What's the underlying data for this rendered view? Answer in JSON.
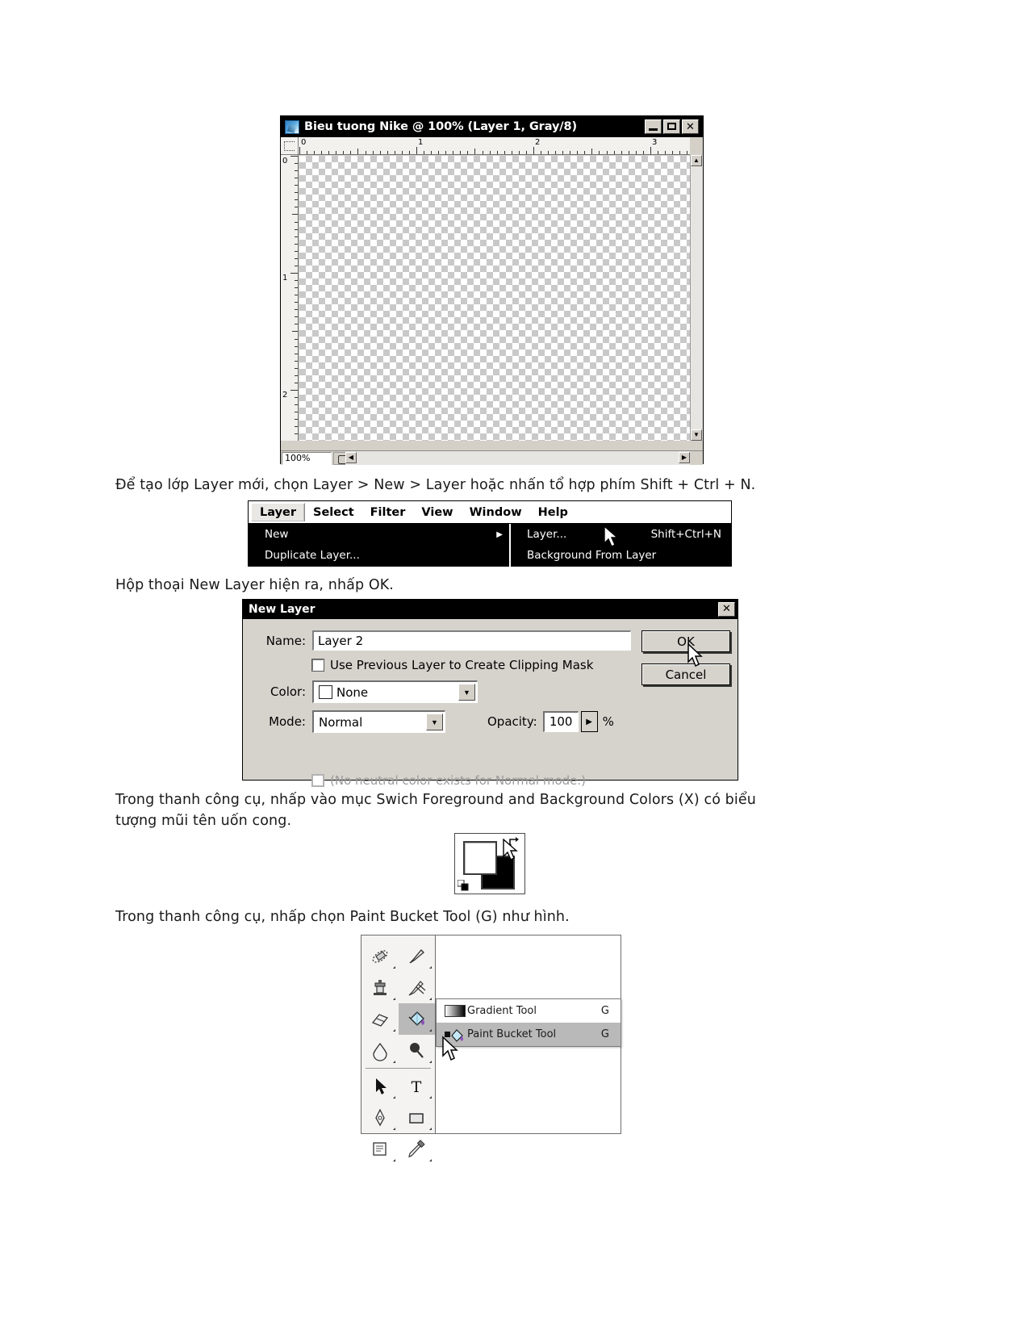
{
  "document_window": {
    "title": "Bieu tuong Nike @ 100% (Layer 1, Gray/8)",
    "app_icon": "photoshop-document-icon",
    "buttons": {
      "minimize": "_",
      "maximize": "□",
      "close": "✕"
    },
    "ruler_h_labels": [
      "0",
      "1",
      "2",
      "3"
    ],
    "ruler_v_labels": [
      "0",
      "1",
      "2"
    ],
    "status": {
      "zoom": "100%",
      "doc_icon": "document-thumbnail-icon"
    }
  },
  "text_blocks": {
    "intro": "Để tạo lớp Layer mới, chọn Layer > New > Layer hoặc nhấn tổ hợp phím Shift + Ctrl + N.",
    "dialog_caption": "Hộp thoại New Layer hiện ra, nhấp OK.",
    "swatch_caption_line1": "Trong thanh công cụ, nhấp vào mục Swich Foreground and Background Colors (X) có biểu",
    "swatch_caption_line2": "tượng mũi tên uốn cong.",
    "bucket_caption": "Trong thanh công cụ, nhấp chọn Paint Bucket Tool (G) như hình."
  },
  "menu_strip": {
    "menubar": [
      {
        "label": "Layer",
        "active": true
      },
      {
        "label": "Select",
        "active": false
      },
      {
        "label": "Filter",
        "active": false
      },
      {
        "label": "View",
        "active": false
      },
      {
        "label": "Window",
        "active": false
      },
      {
        "label": "Help",
        "active": false
      }
    ],
    "layer_menu": [
      {
        "label": "New",
        "submenu_arrow": "▶"
      },
      {
        "label": "Duplicate Layer...",
        "submenu_arrow": ""
      }
    ],
    "new_submenu": [
      {
        "label": "Layer...",
        "accel": "Shift+Ctrl+N"
      },
      {
        "label": "Background From Layer",
        "accel": ""
      }
    ],
    "cursor": "mouse-pointer-cursor"
  },
  "new_layer_dialog": {
    "title": "New Layer",
    "close_label": "✕",
    "name_label": "Name:",
    "name_value": "Layer 2",
    "clipping_checkbox_label": "Use Previous Layer to Create Clipping Mask",
    "clipping_checked": false,
    "color_label": "Color:",
    "color_value": "None",
    "color_swatch": "#ffffff",
    "mode_label": "Mode:",
    "mode_value": "Normal",
    "opacity_label": "Opacity:",
    "opacity_value": "100",
    "opacity_unit": "%",
    "neutral_note": "(No neutral color exists for Normal mode.)",
    "neutral_checked": false,
    "ok_label": "OK",
    "cancel_label": "Cancel",
    "cursor": "mouse-pointer-cursor"
  },
  "swatch_widget": {
    "foreground_color": "#ffffff",
    "background_color": "#000000",
    "swap_icon": "swap-colors-arrow-icon",
    "default_icon": "default-colors-icon",
    "cursor": "mouse-pointer-cursor"
  },
  "toolbox": {
    "tools": [
      {
        "name": "healing-brush-tool",
        "selected": false
      },
      {
        "name": "brush-tool",
        "selected": false
      },
      {
        "name": "clone-stamp-tool",
        "selected": false
      },
      {
        "name": "history-brush-tool",
        "selected": false
      },
      {
        "name": "eraser-tool",
        "selected": false
      },
      {
        "name": "paint-bucket-tool",
        "selected": true
      },
      {
        "name": "blur-tool",
        "selected": false
      },
      {
        "name": "dodge-tool",
        "selected": false
      },
      {
        "name": "path-selection-tool",
        "selected": false
      },
      {
        "name": "type-tool",
        "selected": false
      },
      {
        "name": "pen-tool",
        "selected": false
      },
      {
        "name": "rectangle-tool",
        "selected": false
      },
      {
        "name": "notes-tool",
        "selected": false
      },
      {
        "name": "eyedropper-tool",
        "selected": false
      }
    ],
    "flyout": [
      {
        "label": "Gradient Tool",
        "key": "G",
        "selected": false,
        "icon": "gradient-icon"
      },
      {
        "label": "Paint Bucket Tool",
        "key": "G",
        "selected": true,
        "icon": "paint-bucket-icon"
      }
    ],
    "cursor": "mouse-pointer-cursor"
  }
}
